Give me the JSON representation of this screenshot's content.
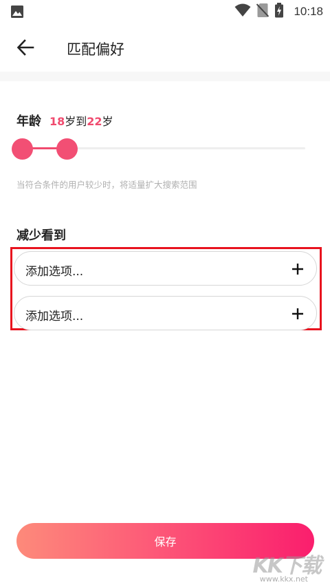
{
  "status_bar": {
    "time": "10:18",
    "icons": [
      "image-icon",
      "wifi-icon",
      "no-sim-icon",
      "battery-charging-icon"
    ]
  },
  "header": {
    "title": "匹配偏好",
    "back_icon": "arrow-left-icon"
  },
  "age": {
    "label": "年龄",
    "min": "18",
    "max": "22",
    "unit_sep": "岁到",
    "unit_end": "岁",
    "slider_range_fraction": [
      0.0,
      0.12
    ],
    "accent_color": "#f04a6e"
  },
  "hint": "当符合条件的用户较少时，将适量扩大搜索范围",
  "reduce": {
    "title": "减少看到",
    "options": [
      {
        "label": "添加选项..."
      },
      {
        "label": "添加选项..."
      }
    ],
    "plus_icon": "plus-icon",
    "highlight_color": "#e8121e"
  },
  "save": {
    "label": "保存",
    "gradient": [
      "#fd8a7a",
      "#fa1e6d"
    ]
  },
  "watermark": {
    "big": "KK下载",
    "small": "www.kkx.net"
  }
}
